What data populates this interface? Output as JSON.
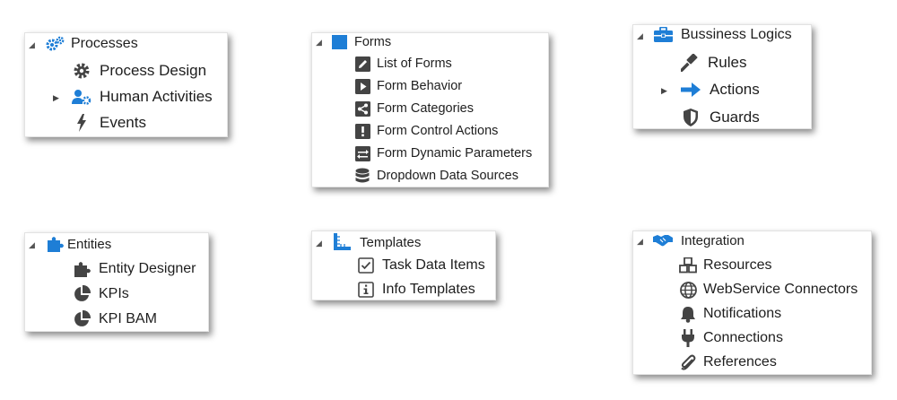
{
  "colors": {
    "accent": "#1e7ed6",
    "icon_gray": "#444444",
    "frame": "#e2e2e2"
  },
  "processes": {
    "title": "Processes",
    "items": [
      {
        "label": "Process Design",
        "icon": "gear-icon"
      },
      {
        "label": "Human Activities",
        "icon": "users-gear-icon",
        "collapsible": true
      },
      {
        "label": "Events",
        "icon": "lightning-icon"
      }
    ]
  },
  "forms": {
    "title": "Forms",
    "items": [
      {
        "label": "List of Forms",
        "icon": "pencil-icon"
      },
      {
        "label": "Form Behavior",
        "icon": "play-icon"
      },
      {
        "label": "Form Categories",
        "icon": "share-icon"
      },
      {
        "label": "Form Control Actions",
        "icon": "exclamation-icon"
      },
      {
        "label": "Form Dynamic Parameters",
        "icon": "exchange-icon"
      },
      {
        "label": "Dropdown Data Sources",
        "icon": "database-icon"
      }
    ]
  },
  "business": {
    "title": "Bussiness Logics",
    "items": [
      {
        "label": "Rules",
        "icon": "gavel-icon"
      },
      {
        "label": "Actions",
        "icon": "arrow-right-icon",
        "collapsible": true
      },
      {
        "label": "Guards",
        "icon": "shield-icon"
      }
    ]
  },
  "entities": {
    "title": "Entities",
    "items": [
      {
        "label": "Entity Designer",
        "icon": "puzzle-icon"
      },
      {
        "label": "KPIs",
        "icon": "pie-chart-icon"
      },
      {
        "label": "KPI BAM",
        "icon": "pie-chart-icon"
      }
    ]
  },
  "templates": {
    "title": "Templates",
    "items": [
      {
        "label": "Task Data Items",
        "icon": "checkbox-icon"
      },
      {
        "label": "Info Templates",
        "icon": "info-icon"
      }
    ]
  },
  "integration": {
    "title": "Integration",
    "items": [
      {
        "label": "Resources",
        "icon": "cubes-icon"
      },
      {
        "label": "WebService Connectors",
        "icon": "globe-icon"
      },
      {
        "label": "Notifications",
        "icon": "bell-icon"
      },
      {
        "label": "Connections",
        "icon": "plug-icon"
      },
      {
        "label": "References",
        "icon": "paperclip-icon"
      }
    ]
  }
}
